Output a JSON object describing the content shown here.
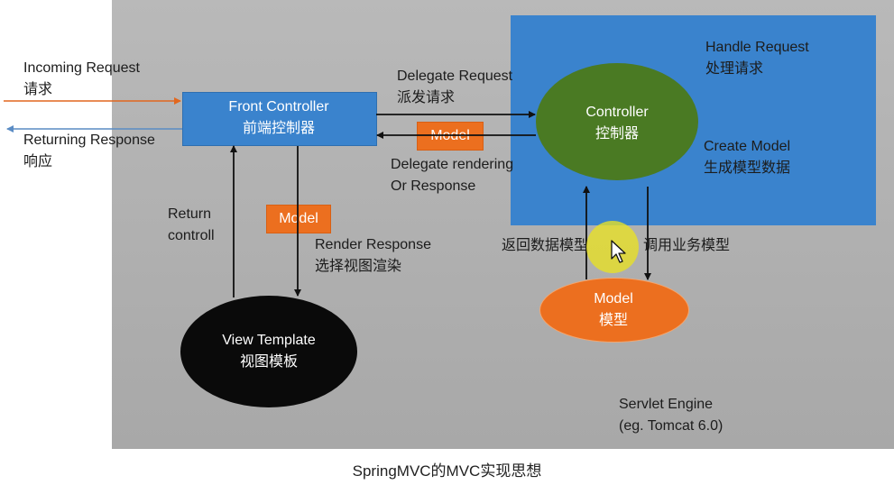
{
  "left_labels": {
    "incoming_en": "Incoming Request",
    "incoming_cn": "请求",
    "returning_en": "Returning Response",
    "returning_cn": "响应"
  },
  "front_controller": {
    "line1": "Front  Controller",
    "line2": "前端控制器"
  },
  "delegate_request": {
    "line1": "Delegate Request",
    "line2": "派发请求"
  },
  "delegate_rendering": {
    "line1": "Delegate rendering",
    "line2": "Or Response"
  },
  "model_tag_top": "Model",
  "model_tag_mid": "Model",
  "controller": {
    "line1": "Controller",
    "line2": "控制器"
  },
  "handle_request": {
    "line1": "Handle Request",
    "line2": "处理请求"
  },
  "create_model": {
    "line1": "Create Model",
    "line2": "生成模型数据"
  },
  "return_controll": {
    "line1": "Return",
    "line2": "controll"
  },
  "render_response": {
    "line1": "Render Response",
    "line2": "选择视图渲染"
  },
  "view_template": {
    "line1": "View Template",
    "line2": "视图模板"
  },
  "return_model_cn": "返回数据模型",
  "call_model_cn": "调用业务模型",
  "model_node": {
    "line1": "Model",
    "line2": "模型"
  },
  "servlet_engine": {
    "line1": "Servlet Engine",
    "line2": "(eg. Tomcat 6.0)"
  },
  "caption": "SpringMVC的MVC实现思想",
  "colors": {
    "panel_grey": "#b0b0b0",
    "panel_blue": "#3a83cd",
    "controller_green": "#4a7a23",
    "model_orange": "#ec6f1f",
    "view_black": "#0a0a0a",
    "incoming_arrow": "#e2671e",
    "returning_arrow": "#5a8cc4"
  }
}
